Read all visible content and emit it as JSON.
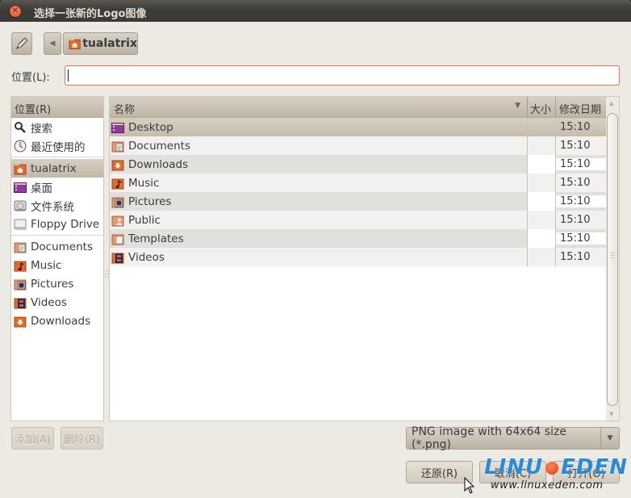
{
  "window": {
    "title": "选择一张新的Logo图像"
  },
  "toolbar": {
    "path_button": "tualatrix"
  },
  "location": {
    "label": "位置(L):",
    "value": "",
    "placeholder": ""
  },
  "places": {
    "header": "位置(R)",
    "items": [
      {
        "label": "搜索",
        "icon": "search-icon"
      },
      {
        "label": "最近使用的",
        "icon": "recent-icon"
      },
      {
        "label": "tualatrix",
        "icon": "home-folder-icon",
        "selected": true
      },
      {
        "label": "桌面",
        "icon": "desktop-icon"
      },
      {
        "label": "文件系统",
        "icon": "drive-icon"
      },
      {
        "label": "Floppy Drive",
        "icon": "floppy-icon"
      },
      {
        "label": "Documents",
        "icon": "documents-folder-icon"
      },
      {
        "label": "Music",
        "icon": "music-folder-icon"
      },
      {
        "label": "Pictures",
        "icon": "pictures-folder-icon"
      },
      {
        "label": "Videos",
        "icon": "videos-folder-icon"
      },
      {
        "label": "Downloads",
        "icon": "downloads-folder-icon"
      }
    ],
    "add_label": "添加(A)",
    "remove_label": "删除(R)"
  },
  "files": {
    "columns": {
      "name": "名称",
      "size": "大小",
      "modified": "修改日期"
    },
    "rows": [
      {
        "name": "Desktop",
        "size": "",
        "modified": "15:10",
        "icon": "desktop-icon"
      },
      {
        "name": "Documents",
        "size": "",
        "modified": "15:10",
        "icon": "documents-folder-icon"
      },
      {
        "name": "Downloads",
        "size": "",
        "modified": "15:10",
        "icon": "downloads-folder-icon"
      },
      {
        "name": "Music",
        "size": "",
        "modified": "15:10",
        "icon": "music-folder-icon"
      },
      {
        "name": "Pictures",
        "size": "",
        "modified": "15:10",
        "icon": "pictures-folder-icon"
      },
      {
        "name": "Public",
        "size": "",
        "modified": "15:10",
        "icon": "public-folder-icon"
      },
      {
        "name": "Templates",
        "size": "",
        "modified": "15:10",
        "icon": "templates-folder-icon"
      },
      {
        "name": "Videos",
        "size": "",
        "modified": "15:10",
        "icon": "videos-folder-icon"
      }
    ]
  },
  "filter": {
    "selected": "PNG image with 64x64 size (*.png)"
  },
  "actions": {
    "revert_label": "还原(R)",
    "cancel_label": "取消(C)",
    "open_label": "打开(O)"
  },
  "watermark": {
    "logo_left": "LINU",
    "logo_right": "EDEN",
    "url": "www.linuxeden.com"
  },
  "colors": {
    "titlebar": "#3c3b37",
    "window_bg": "#edeae4",
    "input_focus_border": "#e8765a",
    "selection": "#c6bcac"
  }
}
